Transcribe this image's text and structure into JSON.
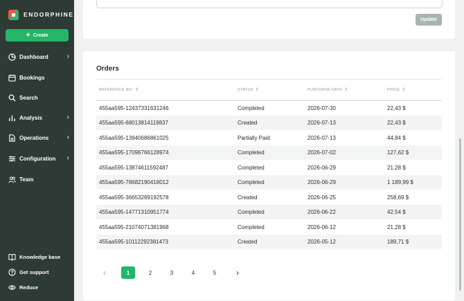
{
  "brand": {
    "name": "ENDORPHINE"
  },
  "sidebar": {
    "create_label": "Create",
    "items": [
      {
        "label": "Dashboard",
        "icon": "pie-chart-icon",
        "has_submenu": true
      },
      {
        "label": "Bookings",
        "icon": "calendar-icon",
        "has_submenu": false
      },
      {
        "label": "Search",
        "icon": "search-icon",
        "has_submenu": false
      },
      {
        "label": "Analysis",
        "icon": "bar-chart-icon",
        "has_submenu": true
      },
      {
        "label": "Operations",
        "icon": "file-gear-icon",
        "has_submenu": true
      },
      {
        "label": "Configuration",
        "icon": "sliders-icon",
        "has_submenu": true
      },
      {
        "label": "Team",
        "icon": "team-icon",
        "has_submenu": false
      }
    ],
    "footer": [
      {
        "label": "Knowledge base",
        "icon": "book-icon"
      },
      {
        "label": "Get support",
        "icon": "help-icon"
      },
      {
        "label": "Reduce",
        "icon": "eye-icon"
      }
    ]
  },
  "top_card": {
    "update_label": "Update"
  },
  "orders": {
    "title": "Orders",
    "columns": [
      "REFERENCE NO.",
      "STATUS",
      "PURCHASE DATE",
      "PRICE"
    ],
    "rows": [
      {
        "ref": "455aa595-12437331631246",
        "status": "Completed",
        "date": "2026-07-30",
        "price": "22,43 $"
      },
      {
        "ref": "455aa595-68013814119837",
        "status": "Created",
        "date": "2026-07-13",
        "price": "22,43 $"
      },
      {
        "ref": "455aa595-13940686861025",
        "status": "Partially Paid",
        "date": "2026-07-13",
        "price": "44,84 $"
      },
      {
        "ref": "455aa595-17096766128974",
        "status": "Completed",
        "date": "2026-07-02",
        "price": "127,62 $"
      },
      {
        "ref": "455aa595-13874611592487",
        "status": "Completed",
        "date": "2026-06-29",
        "price": "21,28 $"
      },
      {
        "ref": "455aa595-78682190418012",
        "status": "Completed",
        "date": "2026-06-29",
        "price": "1 189,99 $"
      },
      {
        "ref": "455aa595-36653269192578",
        "status": "Created",
        "date": "2026-06-25",
        "price": "258,69 $"
      },
      {
        "ref": "455aa595-14771310951774",
        "status": "Completed",
        "date": "2026-06-22",
        "price": "42,54 $"
      },
      {
        "ref": "455aa595-21074071381968",
        "status": "Completed",
        "date": "2026-06-12",
        "price": "21,28 $"
      },
      {
        "ref": "455aa595-10112292381473",
        "status": "Created",
        "date": "2026-05-12",
        "price": "189,71 $"
      }
    ]
  },
  "pagination": {
    "pages": [
      "1",
      "2",
      "3",
      "4",
      "5"
    ],
    "current": "1",
    "prev_icon": "chevron-left-icon",
    "next_icon": "chevron-right-icon"
  },
  "colors": {
    "sidebar_bg": "#2d3a36",
    "accent": "#24b567",
    "button_disabled": "#a9b4b1"
  }
}
